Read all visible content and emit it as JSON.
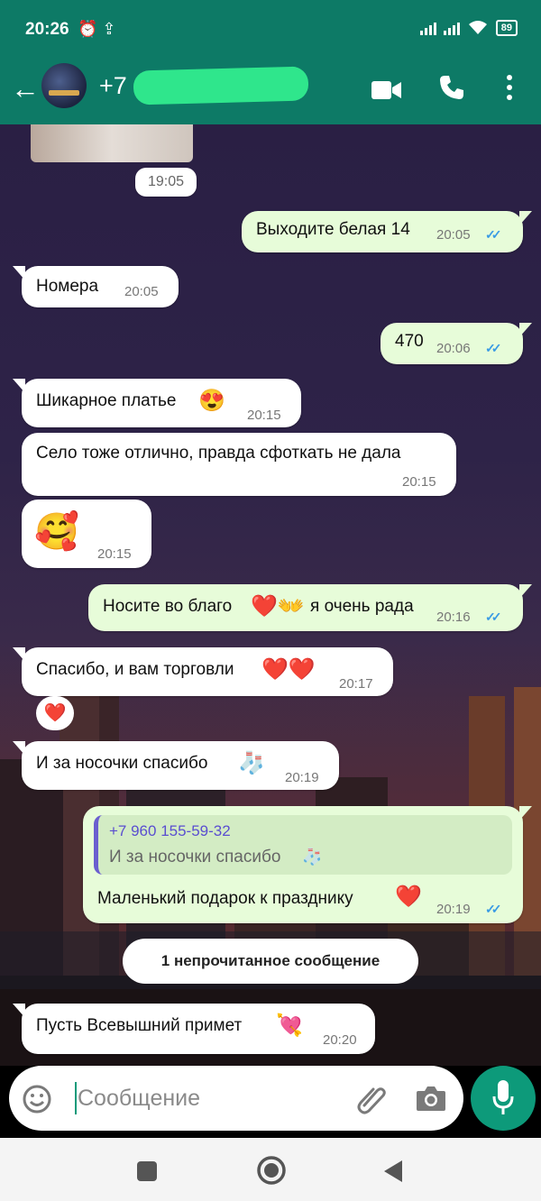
{
  "status_bar": {
    "time": "20:26",
    "battery": "89"
  },
  "header": {
    "contact_prefix": "+7 9"
  },
  "date_chip": "19:05",
  "messages": [
    {
      "dir": "out",
      "text": "Выходите белая 14",
      "time": "20:05",
      "read": true
    },
    {
      "dir": "in",
      "text": "Номера",
      "time": "20:05"
    },
    {
      "dir": "out",
      "text": "470",
      "time": "20:06",
      "read": true
    },
    {
      "dir": "in",
      "text": "Шикарное платье",
      "emoji": "😍",
      "time": "20:15"
    },
    {
      "dir": "in",
      "text": "Село тоже отлично, правда сфоткать не дала",
      "time": "20:15"
    },
    {
      "dir": "in",
      "text": "",
      "emoji": "🥰",
      "time": "20:15"
    },
    {
      "dir": "out",
      "text": "Носите во благо",
      "emoji": "❤️👐",
      "text2": "я очень рада",
      "time": "20:16",
      "read": true
    },
    {
      "dir": "in",
      "text": "Спасибо, и вам торговли",
      "emoji": "❤️❤️",
      "time": "20:17",
      "reaction": "❤️"
    },
    {
      "dir": "in",
      "text": "И за носочки спасибо",
      "emoji": "🧦",
      "time": "20:19"
    },
    {
      "dir": "out",
      "quote": {
        "name": "+7 960 155-59-32",
        "text": "И за носочки спасибо",
        "emoji": "🧦"
      },
      "text": "Маленький подарок к празднику",
      "emoji": "❤️",
      "time": "20:19",
      "read": true
    },
    {
      "dir": "in",
      "text": "Пусть Всевышний примет",
      "emoji": "💘",
      "time": "20:20"
    }
  ],
  "unread_label": "1 непрочитанное сообщение",
  "composer": {
    "placeholder": "Сообщение"
  },
  "icons": [
    "back-arrow-icon",
    "video-call-icon",
    "phone-icon",
    "more-vert-icon",
    "emoji-icon",
    "attach-icon",
    "camera-icon",
    "mic-icon",
    "nav-recents-icon",
    "nav-home-icon",
    "nav-back-icon"
  ],
  "colors": {
    "header": "#0d7a66",
    "out_bubble": "#e7fcd9",
    "in_bubble": "#ffffff",
    "ticks": "#3a9be4",
    "accent": "#0d9a7a"
  }
}
